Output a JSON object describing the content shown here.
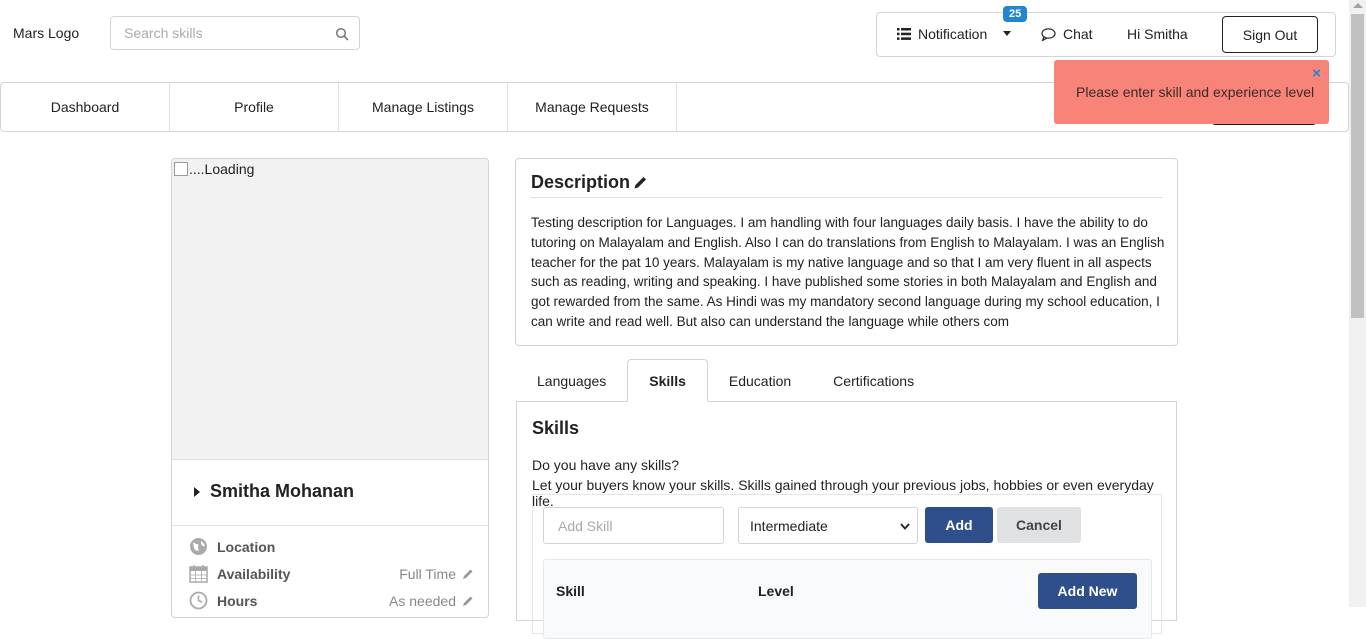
{
  "header": {
    "logo": "Mars Logo",
    "search_placeholder": "Search skills",
    "notification_label": "Notification",
    "notification_count": "25",
    "chat_label": "Chat",
    "greeting": "Hi Smitha",
    "signout_label": "Sign Out"
  },
  "nav": {
    "items": [
      {
        "label": "Dashboard"
      },
      {
        "label": "Profile"
      },
      {
        "label": "Manage Listings"
      },
      {
        "label": "Manage Requests"
      }
    ]
  },
  "toast": {
    "message": "Please enter skill and experience level",
    "close": "×"
  },
  "profile": {
    "image_alt": "....Loading",
    "name": "Smitha Mohanan",
    "rows": [
      {
        "label": "Location",
        "value": ""
      },
      {
        "label": "Availability",
        "value": "Full Time"
      },
      {
        "label": "Hours",
        "value": "As needed"
      }
    ]
  },
  "description": {
    "title": "Description",
    "text": "Testing description for Languages. I am handling with four languages daily basis. I have the ability to do tutoring on Malayalam and English. Also I can do translations from English to Malayalam. I was an English teacher for the pat 10 years. Malayalam is my native language and so that I am very fluent in all aspects such as reading, writing and speaking. I have published some stories in both Malayalam and English and got rewarded from the same. As Hindi was my mandatory second language during my school education, I can write and read well. But also can understand the language while others com"
  },
  "tabs": [
    {
      "label": "Languages"
    },
    {
      "label": "Skills"
    },
    {
      "label": "Education"
    },
    {
      "label": "Certifications"
    }
  ],
  "skills": {
    "title": "Skills",
    "question": "Do you have any skills?",
    "subtitle": "Let your buyers know your skills. Skills gained through your previous jobs, hobbies or even everyday life.",
    "input_placeholder": "Add Skill",
    "level_selected": "Intermediate",
    "add_label": "Add",
    "cancel_label": "Cancel",
    "col_skill": "Skill",
    "col_level": "Level",
    "add_new_label": "Add New"
  },
  "colors": {
    "accent": "#2e4f8c",
    "badge": "#2185d0",
    "toast": "#f88379"
  }
}
